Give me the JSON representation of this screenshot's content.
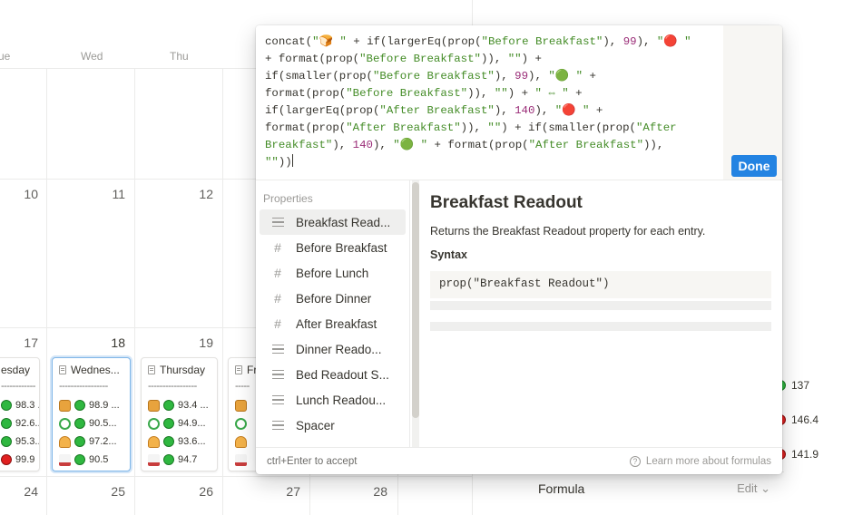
{
  "calendar": {
    "weekdays": [
      "ue",
      "Wed",
      "Thu"
    ],
    "row2_days": [
      "10",
      "11",
      "12"
    ],
    "row3_days": [
      "17",
      "18",
      "19"
    ],
    "row4_days": [
      "24",
      "25",
      "26",
      "27",
      "28"
    ],
    "cards": [
      {
        "title": "esday",
        "dash": "------------",
        "rows": [
          {
            "emoji": "bread",
            "dot": "green",
            "value": "98.3 ..."
          },
          {
            "emoji": "salad",
            "dot": "green",
            "value": "92.6..."
          },
          {
            "emoji": "taco",
            "dot": "green",
            "value": "95.3..."
          },
          {
            "emoji": "bed",
            "dot": "red",
            "value": "99.9"
          }
        ]
      },
      {
        "title": "Wednes...",
        "dash": "-----------------",
        "rows": [
          {
            "emoji": "bread",
            "dot": "green",
            "value": "98.9 ..."
          },
          {
            "emoji": "salad",
            "dot": "green",
            "value": "90.5..."
          },
          {
            "emoji": "taco",
            "dot": "green",
            "value": "97.2..."
          },
          {
            "emoji": "bed",
            "dot": "green",
            "value": "90.5"
          }
        ]
      },
      {
        "title": "Thursday",
        "dash": "-----------------",
        "rows": [
          {
            "emoji": "bread",
            "dot": "green",
            "value": "93.4 ..."
          },
          {
            "emoji": "salad",
            "dot": "green",
            "value": "94.9..."
          },
          {
            "emoji": "taco",
            "dot": "green",
            "value": "93.6..."
          },
          {
            "emoji": "bed",
            "dot": "green",
            "value": "94.7"
          }
        ]
      },
      {
        "title": "Fr",
        "dash": "-----",
        "rows": [
          {
            "emoji": "bread",
            "dot": "",
            "value": ""
          },
          {
            "emoji": "salad",
            "dot": "",
            "value": ""
          },
          {
            "emoji": "taco",
            "dot": "",
            "value": ""
          },
          {
            "emoji": "bed",
            "dot": "",
            "value": ""
          }
        ]
      }
    ]
  },
  "side_panel": {
    "values": [
      {
        "dot": "green",
        "value": "137"
      },
      {
        "dot": "red",
        "value": "146.4"
      },
      {
        "dot": "red",
        "value": "141.9"
      }
    ],
    "formula_label": "Formula",
    "edit_label": "Edit"
  },
  "editor": {
    "code_lines": [
      [
        {
          "t": "concat("
        },
        {
          "t": "\"🍞 \"",
          "c": "s"
        },
        {
          "t": " + if(largerEq(prop("
        },
        {
          "t": "\"Before Breakfast\"",
          "c": "s"
        },
        {
          "t": "), "
        },
        {
          "t": "99",
          "c": "n"
        },
        {
          "t": "), "
        },
        {
          "t": "\"🔴 \"",
          "c": "s"
        }
      ],
      [
        {
          "t": "+ format(prop("
        },
        {
          "t": "\"Before Breakfast\"",
          "c": "s"
        },
        {
          "t": ")), "
        },
        {
          "t": "\"\"",
          "c": "s"
        },
        {
          "t": ") +"
        }
      ],
      [
        {
          "t": "if(smaller(prop("
        },
        {
          "t": "\"Before Breakfast\"",
          "c": "s"
        },
        {
          "t": "), "
        },
        {
          "t": "99",
          "c": "n"
        },
        {
          "t": "), "
        },
        {
          "t": "\"🟢 \"",
          "c": "s"
        },
        {
          "t": " +"
        }
      ],
      [
        {
          "t": "format(prop("
        },
        {
          "t": "\"Before Breakfast\"",
          "c": "s"
        },
        {
          "t": ")), "
        },
        {
          "t": "\"\"",
          "c": "s"
        },
        {
          "t": ") + "
        },
        {
          "t": "\" ⇔ \"",
          "c": "s"
        },
        {
          "t": " +"
        }
      ],
      [
        {
          "t": "if(largerEq(prop("
        },
        {
          "t": "\"After Breakfast\"",
          "c": "s"
        },
        {
          "t": "), "
        },
        {
          "t": "140",
          "c": "n"
        },
        {
          "t": "), "
        },
        {
          "t": "\"🔴 \"",
          "c": "s"
        },
        {
          "t": " +"
        }
      ],
      [
        {
          "t": "format(prop("
        },
        {
          "t": "\"After Breakfast\"",
          "c": "s"
        },
        {
          "t": ")), "
        },
        {
          "t": "\"\"",
          "c": "s"
        },
        {
          "t": ") + if(smaller(prop("
        },
        {
          "t": "\"After",
          "c": "s"
        }
      ],
      [
        {
          "t": "Breakfast\"",
          "c": "s"
        },
        {
          "t": "), "
        },
        {
          "t": "140",
          "c": "n"
        },
        {
          "t": "), "
        },
        {
          "t": "\"🟢 \"",
          "c": "s"
        },
        {
          "t": " + format(prop("
        },
        {
          "t": "\"After Breakfast\"",
          "c": "s"
        },
        {
          "t": ")),"
        }
      ],
      [
        {
          "t": "\"\"",
          "c": "s"
        },
        {
          "t": "))"
        }
      ]
    ],
    "done_label": "Done",
    "properties_header": "Properties",
    "properties": [
      {
        "icon": "lines",
        "label": "Breakfast Read..."
      },
      {
        "icon": "hash",
        "label": "Before Breakfast"
      },
      {
        "icon": "hash",
        "label": "Before Lunch"
      },
      {
        "icon": "hash",
        "label": "Before Dinner"
      },
      {
        "icon": "hash",
        "label": "After Breakfast"
      },
      {
        "icon": "lines",
        "label": "Dinner Reado..."
      },
      {
        "icon": "lines",
        "label": "Bed Readout S..."
      },
      {
        "icon": "lines",
        "label": "Lunch Readou..."
      },
      {
        "icon": "lines",
        "label": "Spacer"
      }
    ],
    "help": {
      "title": "Breakfast Readout",
      "description": "Returns the Breakfast Readout property for each entry.",
      "syntax_label": "Syntax",
      "syntax_code": "prop(\"Breakfast Readout\")"
    },
    "footer": {
      "shortcut_key": "ctrl+Enter",
      "shortcut_text": " to accept",
      "learn_more": "Learn more about formulas"
    }
  }
}
